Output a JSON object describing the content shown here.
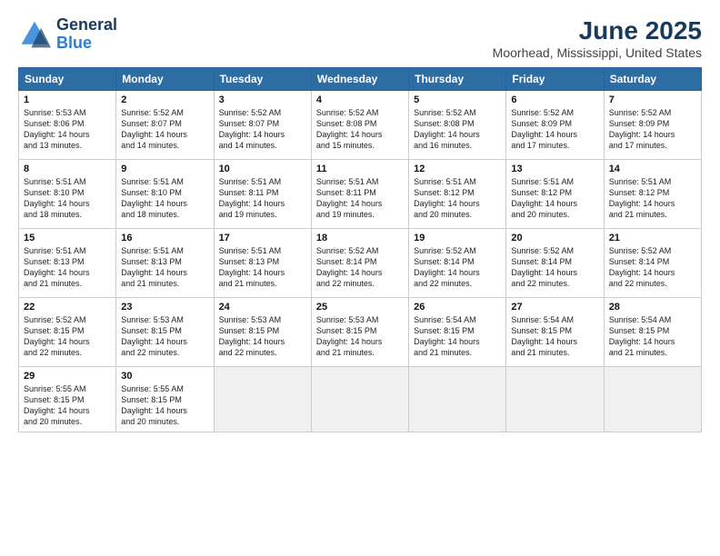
{
  "logo": {
    "line1": "General",
    "line2": "Blue"
  },
  "title": {
    "month_year": "June 2025",
    "location": "Moorhead, Mississippi, United States"
  },
  "header_days": [
    "Sunday",
    "Monday",
    "Tuesday",
    "Wednesday",
    "Thursday",
    "Friday",
    "Saturday"
  ],
  "weeks": [
    [
      {
        "day": "1",
        "info": "Sunrise: 5:53 AM\nSunset: 8:06 PM\nDaylight: 14 hours\nand 13 minutes."
      },
      {
        "day": "2",
        "info": "Sunrise: 5:52 AM\nSunset: 8:07 PM\nDaylight: 14 hours\nand 14 minutes."
      },
      {
        "day": "3",
        "info": "Sunrise: 5:52 AM\nSunset: 8:07 PM\nDaylight: 14 hours\nand 14 minutes."
      },
      {
        "day": "4",
        "info": "Sunrise: 5:52 AM\nSunset: 8:08 PM\nDaylight: 14 hours\nand 15 minutes."
      },
      {
        "day": "5",
        "info": "Sunrise: 5:52 AM\nSunset: 8:08 PM\nDaylight: 14 hours\nand 16 minutes."
      },
      {
        "day": "6",
        "info": "Sunrise: 5:52 AM\nSunset: 8:09 PM\nDaylight: 14 hours\nand 17 minutes."
      },
      {
        "day": "7",
        "info": "Sunrise: 5:52 AM\nSunset: 8:09 PM\nDaylight: 14 hours\nand 17 minutes."
      }
    ],
    [
      {
        "day": "8",
        "info": "Sunrise: 5:51 AM\nSunset: 8:10 PM\nDaylight: 14 hours\nand 18 minutes."
      },
      {
        "day": "9",
        "info": "Sunrise: 5:51 AM\nSunset: 8:10 PM\nDaylight: 14 hours\nand 18 minutes."
      },
      {
        "day": "10",
        "info": "Sunrise: 5:51 AM\nSunset: 8:11 PM\nDaylight: 14 hours\nand 19 minutes."
      },
      {
        "day": "11",
        "info": "Sunrise: 5:51 AM\nSunset: 8:11 PM\nDaylight: 14 hours\nand 19 minutes."
      },
      {
        "day": "12",
        "info": "Sunrise: 5:51 AM\nSunset: 8:12 PM\nDaylight: 14 hours\nand 20 minutes."
      },
      {
        "day": "13",
        "info": "Sunrise: 5:51 AM\nSunset: 8:12 PM\nDaylight: 14 hours\nand 20 minutes."
      },
      {
        "day": "14",
        "info": "Sunrise: 5:51 AM\nSunset: 8:12 PM\nDaylight: 14 hours\nand 21 minutes."
      }
    ],
    [
      {
        "day": "15",
        "info": "Sunrise: 5:51 AM\nSunset: 8:13 PM\nDaylight: 14 hours\nand 21 minutes."
      },
      {
        "day": "16",
        "info": "Sunrise: 5:51 AM\nSunset: 8:13 PM\nDaylight: 14 hours\nand 21 minutes."
      },
      {
        "day": "17",
        "info": "Sunrise: 5:51 AM\nSunset: 8:13 PM\nDaylight: 14 hours\nand 21 minutes."
      },
      {
        "day": "18",
        "info": "Sunrise: 5:52 AM\nSunset: 8:14 PM\nDaylight: 14 hours\nand 22 minutes."
      },
      {
        "day": "19",
        "info": "Sunrise: 5:52 AM\nSunset: 8:14 PM\nDaylight: 14 hours\nand 22 minutes."
      },
      {
        "day": "20",
        "info": "Sunrise: 5:52 AM\nSunset: 8:14 PM\nDaylight: 14 hours\nand 22 minutes."
      },
      {
        "day": "21",
        "info": "Sunrise: 5:52 AM\nSunset: 8:14 PM\nDaylight: 14 hours\nand 22 minutes."
      }
    ],
    [
      {
        "day": "22",
        "info": "Sunrise: 5:52 AM\nSunset: 8:15 PM\nDaylight: 14 hours\nand 22 minutes."
      },
      {
        "day": "23",
        "info": "Sunrise: 5:53 AM\nSunset: 8:15 PM\nDaylight: 14 hours\nand 22 minutes."
      },
      {
        "day": "24",
        "info": "Sunrise: 5:53 AM\nSunset: 8:15 PM\nDaylight: 14 hours\nand 22 minutes."
      },
      {
        "day": "25",
        "info": "Sunrise: 5:53 AM\nSunset: 8:15 PM\nDaylight: 14 hours\nand 21 minutes."
      },
      {
        "day": "26",
        "info": "Sunrise: 5:54 AM\nSunset: 8:15 PM\nDaylight: 14 hours\nand 21 minutes."
      },
      {
        "day": "27",
        "info": "Sunrise: 5:54 AM\nSunset: 8:15 PM\nDaylight: 14 hours\nand 21 minutes."
      },
      {
        "day": "28",
        "info": "Sunrise: 5:54 AM\nSunset: 8:15 PM\nDaylight: 14 hours\nand 21 minutes."
      }
    ],
    [
      {
        "day": "29",
        "info": "Sunrise: 5:55 AM\nSunset: 8:15 PM\nDaylight: 14 hours\nand 20 minutes."
      },
      {
        "day": "30",
        "info": "Sunrise: 5:55 AM\nSunset: 8:15 PM\nDaylight: 14 hours\nand 20 minutes."
      },
      {
        "day": "",
        "info": ""
      },
      {
        "day": "",
        "info": ""
      },
      {
        "day": "",
        "info": ""
      },
      {
        "day": "",
        "info": ""
      },
      {
        "day": "",
        "info": ""
      }
    ]
  ]
}
